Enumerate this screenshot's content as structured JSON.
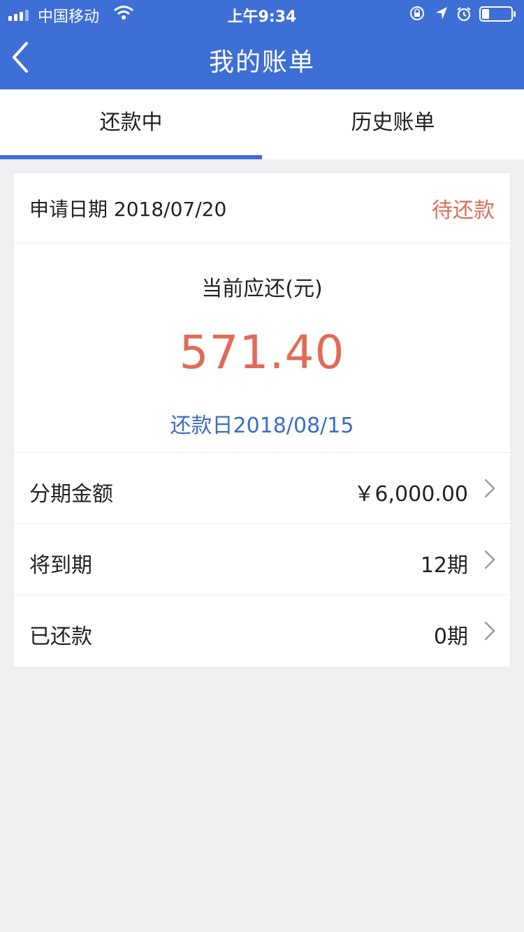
{
  "status_bar": {
    "carrier": "中国移动",
    "time": "上午9:34"
  },
  "nav": {
    "title": "我的账单"
  },
  "tabs": [
    {
      "label": "还款中",
      "active": true
    },
    {
      "label": "历史账单",
      "active": false
    }
  ],
  "bill": {
    "apply_date": "申请日期 2018/07/20",
    "status": "待还款",
    "amount_label": "当前应还(元)",
    "amount_value": "571.40",
    "due_date": "还款日2018/08/15",
    "rows": [
      {
        "label": "分期金额",
        "value": "￥6,000.00"
      },
      {
        "label": "将到期",
        "value": "12期"
      },
      {
        "label": "已还款",
        "value": "0期"
      }
    ]
  },
  "colors": {
    "brand_blue": "#3e6fd6",
    "accent_red": "#e06c56",
    "link_blue": "#3b6dc4",
    "background": "#efeff1"
  },
  "icons": {
    "back": "chevron-left-icon",
    "row_arrow": "chevron-right-icon"
  }
}
